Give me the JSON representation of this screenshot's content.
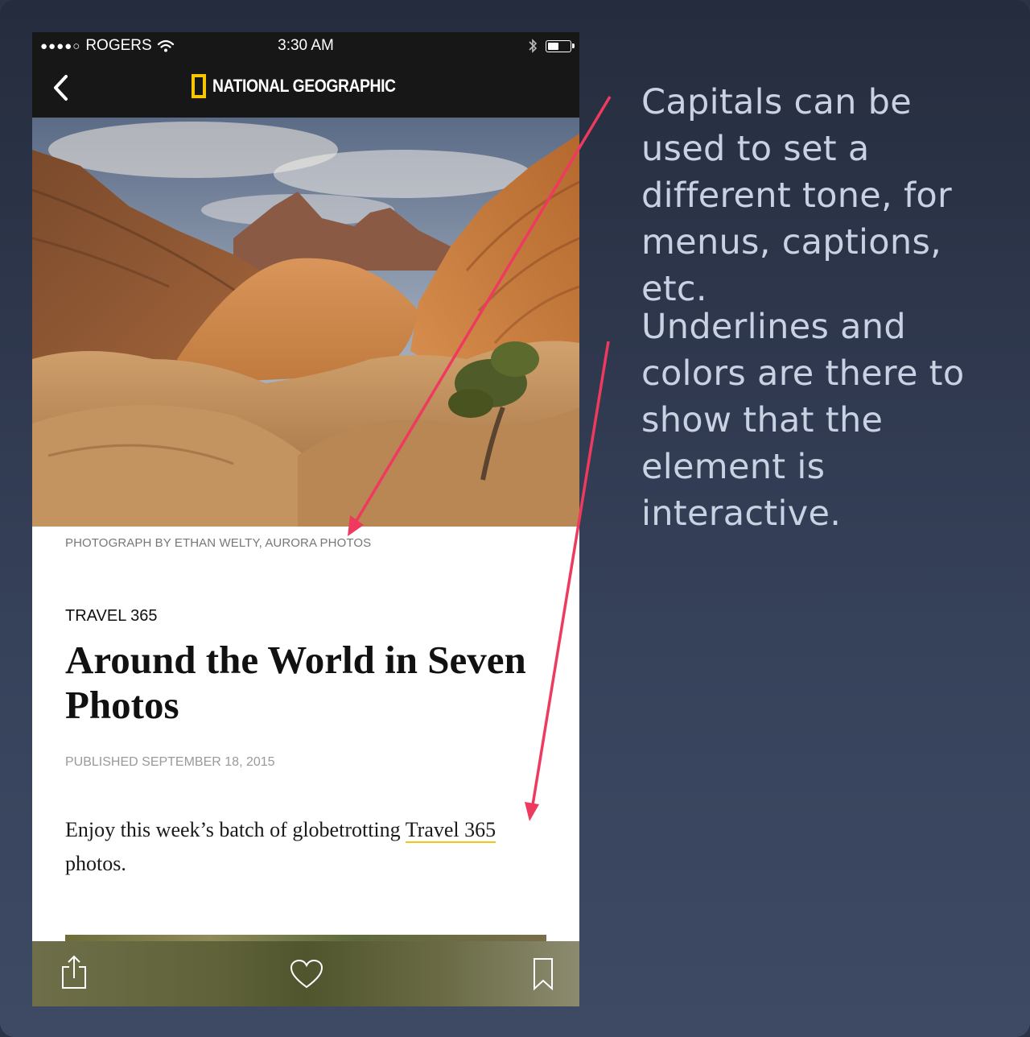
{
  "status_bar": {
    "signal_dots": "●●●●○",
    "carrier": "ROGERS",
    "time": "3:30 AM",
    "battery_level": 0.5
  },
  "nav": {
    "brand": "NATIONAL GEOGRAPHIC"
  },
  "article": {
    "photo_credit": "PHOTOGRAPH BY ETHAN WELTY, AURORA PHOTOS",
    "kicker": "TRAVEL 365",
    "title": "Around the World in Seven Photos",
    "published": "PUBLISHED SEPTEMBER 18, 2015",
    "body_before": "Enjoy this week’s batch of globetrotting ",
    "body_link": "Travel 365",
    "body_after": " photos."
  },
  "toolbar": {
    "icons": [
      "share-icon",
      "heart-icon",
      "bookmark-icon"
    ]
  },
  "annotations": {
    "capitals_note": "Capitals can be used to set a different tone, for menus, captions, etc.",
    "underlines_note": "Underlines and colors are there to show that the element is interactive."
  },
  "colors": {
    "brand_yellow": "#f7c600",
    "link_underline": "#f0c419",
    "arrow": "#ee3a5f",
    "annotation_text": "#c9d2e3"
  }
}
